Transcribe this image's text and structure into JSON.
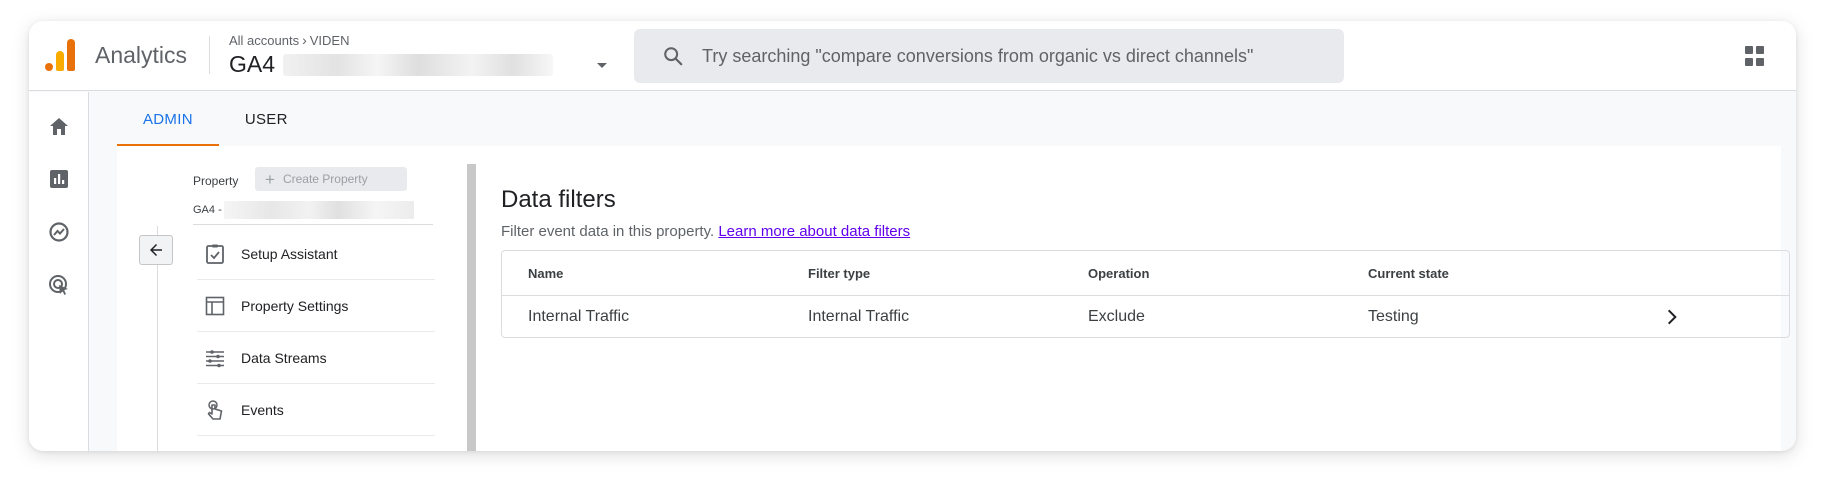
{
  "header": {
    "app_name": "Analytics",
    "breadcrumb_root": "All accounts",
    "breadcrumb_account": "VIDEN",
    "property_title": "GA4",
    "search_placeholder": "Try searching \"compare conversions from organic vs direct channels\""
  },
  "rail": {
    "items": [
      "home-icon",
      "reports-icon",
      "explore-icon",
      "advertising-icon"
    ]
  },
  "tabs": [
    {
      "label": "ADMIN",
      "active": true
    },
    {
      "label": "USER",
      "active": false
    }
  ],
  "property_column": {
    "label": "Property",
    "create_button": "Create Property",
    "property_name_prefix": "GA4 -",
    "nav_items": [
      {
        "label": "Setup Assistant",
        "icon": "clipboard-check-icon"
      },
      {
        "label": "Property Settings",
        "icon": "layout-icon"
      },
      {
        "label": "Data Streams",
        "icon": "streams-icon"
      },
      {
        "label": "Events",
        "icon": "touch-icon"
      }
    ]
  },
  "data_filters": {
    "title": "Data filters",
    "description": "Filter event data in this property.",
    "learn_more": "Learn more about data filters",
    "columns": [
      "Name",
      "Filter type",
      "Operation",
      "Current state"
    ],
    "rows": [
      {
        "name": "Internal Traffic",
        "filter_type": "Internal Traffic",
        "operation": "Exclude",
        "state": "Testing"
      }
    ]
  },
  "colors": {
    "accent_blue": "#1a73e8",
    "tab_underline": "#e8710a",
    "logo_orange": "#e8710a",
    "logo_yellow": "#f9ab00",
    "link_purple": "#6200ee"
  }
}
